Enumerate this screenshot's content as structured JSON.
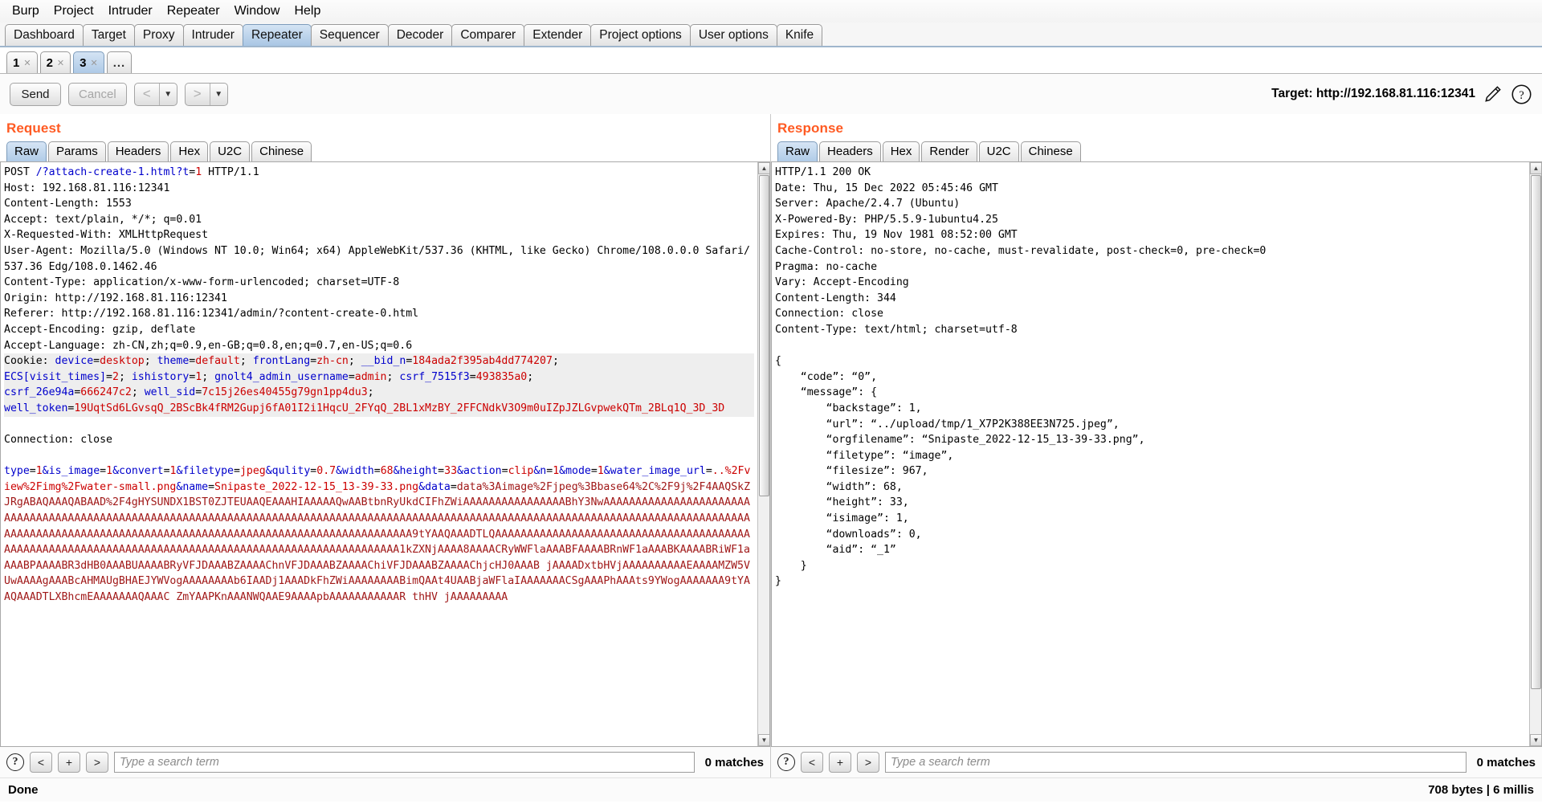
{
  "menubar": {
    "items": [
      "Burp",
      "Project",
      "Intruder",
      "Repeater",
      "Window",
      "Help"
    ]
  },
  "suite_tabs": {
    "items": [
      "Dashboard",
      "Target",
      "Proxy",
      "Intruder",
      "Repeater",
      "Sequencer",
      "Decoder",
      "Comparer",
      "Extender",
      "Project options",
      "User options",
      "Knife"
    ],
    "active": "Repeater"
  },
  "repeater_tabs": {
    "items": [
      "1",
      "2",
      "3"
    ],
    "active": "3",
    "more_label": "..."
  },
  "toolbar": {
    "send_label": "Send",
    "cancel_label": "Cancel",
    "back_arrow": "<",
    "forward_arrow": ">",
    "caret": "▼",
    "target_label": "Target: http://192.168.81.116:12341",
    "edit_icon": "pencil-icon",
    "help_icon": "question-icon"
  },
  "request": {
    "title": "Request",
    "tabs": [
      "Raw",
      "Params",
      "Headers",
      "Hex",
      "U2C",
      "Chinese"
    ],
    "active_tab": "Raw",
    "lines": {
      "l1_method": "POST ",
      "l1_path": "/?attach-create-1.html",
      "l1_q": "?t",
      "l1_eq": "=",
      "l1_val": "1",
      "l1_ver": " HTTP/1.1",
      "host": "Host: 192.168.81.116:12341",
      "content_length": "Content-Length: 1553",
      "accept": "Accept: text/plain, */*; q=0.01",
      "xrw": "X-Requested-With: XMLHttpRequest",
      "ua": "User-Agent: Mozilla/5.0 (Windows NT 10.0; Win64; x64) AppleWebKit/537.36 (KHTML, like Gecko) Chrome/108.0.0.0 Safari/537.36 Edg/108.0.1462.46",
      "content_type": "Content-Type: application/x-www-form-urlencoded; charset=UTF-8",
      "origin": "Origin: http://192.168.81.116:12341",
      "referer": "Referer: http://192.168.81.116:12341/admin/?content-create-0.html",
      "accept_encoding": "Accept-Encoding: gzip, deflate",
      "accept_language": "Accept-Language: zh-CN,zh;q=0.9,en-GB;q=0.8,en;q=0.7,en-US;q=0.6",
      "connection": "Connection: close"
    },
    "cookie": {
      "label": "Cookie: ",
      "pairs": [
        {
          "k": "device",
          "v": "desktop",
          "sep": "; "
        },
        {
          "k": "theme",
          "v": "default",
          "sep": "; "
        },
        {
          "k": "frontLang",
          "v": "zh-cn",
          "sep": "; "
        },
        {
          "k": "__bid_n",
          "v": "184ada2f395ab4dd774207",
          "sep": ";\n"
        },
        {
          "k": "ECS[visit_times]",
          "v": "2",
          "sep": "; "
        },
        {
          "k": "ishistory",
          "v": "1",
          "sep": "; "
        },
        {
          "k": "gnolt4_admin_username",
          "v": "admin",
          "sep": "; "
        },
        {
          "k": "csrf_7515f3",
          "v": "493835a0",
          "sep": ";\n"
        },
        {
          "k": "csrf_26e94a",
          "v": "666247c2",
          "sep": "; "
        },
        {
          "k": "well_sid",
          "v": "7c15j26es40455g79gn1pp4du3",
          "sep": ";\n"
        },
        {
          "k": "well_token",
          "v": "19UqtSd6LGvsqQ_2BScBk4fRM2Gupj6fA01I2i1HqcU_2FYqQ_2BL1xMzBY_2FFCNdkV3O9m0uIZpJZLGvpwekQTm_2BLq1Q_3D_3D",
          "sep": ""
        }
      ]
    },
    "body_params": [
      {
        "k": "type",
        "v": "1",
        "amp": "&"
      },
      {
        "k": "is_image",
        "v": "1",
        "amp": "&"
      },
      {
        "k": "convert",
        "v": "1",
        "amp": "&"
      },
      {
        "k": "filetype",
        "v": "jpeg",
        "amp": "&"
      },
      {
        "k": "qulity",
        "v": "0.7",
        "amp": "&"
      },
      {
        "k": "width",
        "v": "68",
        "amp": "&"
      },
      {
        "k": "height",
        "v": "33",
        "amp": "&"
      },
      {
        "k": "action",
        "v": "clip",
        "amp": "&"
      },
      {
        "k": "n",
        "v": "1",
        "amp": "&"
      },
      {
        "k": "mode",
        "v": "1",
        "amp": "&"
      },
      {
        "k": "water_image_url",
        "v": "..%2Fview%2Fimg%2Fwater-small.png",
        "amp": "&"
      },
      {
        "k": "name",
        "v": "Snipaste_2022-12-15_13-39-33.png",
        "amp": "&"
      },
      {
        "k": "data",
        "v": "",
        "amp": ""
      }
    ],
    "body_data_value": "data%3Aimage%2Fjpeg%3Bbase64%2C%2F9j%2F4AAQSkZJRgABAQAAAQABAAD%2F4gHYSUNDX1BST0ZJTEUAAQEAAAHIAAAAAQwAABtbnRyUkdCIFhZWiAAAAAAAAAAAAAAAABhY3NwAAAAAAAAAAAAAAAAAAAAAAAAAAAAAAAAAAAAAAAAAAAAAAAAAAAAAAAAAAAAAAAAAAAAAAAAAAAAAAAAAAAAAAAAAAAAAAAAAAAAAAAAAAAAAAAAAAAAAAAAAAAAAAAAAAAAAAAAAAAAAAAAAAAAAAAAAAAAAAAAAAAAAAAAAAAAAAAAAAAAAAAAAAAAAAAAAAAAAAAAAAAA9tYAAQAAADTLQAAAAAAAAAAAAAAAAAAAAAAAAAAAAAAAAAAAAAAAAAAAAAAAAAAAAAAAAAAAAAAAAAAAAAAAAAAAAAAAAAAAAAAAAAAAAAAAAAAAAAA1kZXNjAAAA8AAAACRyWWFlaAAABFAAAABRnWF1aAAABKAAAABRiWF1aAAABPAAAABR3dHB0AAABUAAAABRyVFJDAAABZAAAAChnVFJDAAABZAAAAChiVFJDAAABZAAAAChjcHJ0AAAB jAAAADxtbHVjAAAAAAAAAAEAAAAMZW5VUwAAAAgAAABcAHMAUgBHAEJYWVogAAAAAAAAb6IAADj1AAADkFhZWiAAAAAAAABimQAAt4UAABjaWFlaIAAAAAAACSgAAAPhAAAts9YWog",
    "more_b64": "AAAAAAA9tYAAQAAADTLXBhcmEAAAAAAAQAAAC ZmYAAPKnAAANWQAAE9AAAApbAAAAAAAAAAAR thHV jAAAAAAAAA"
  },
  "response": {
    "title": "Response",
    "tabs": [
      "Raw",
      "Headers",
      "Hex",
      "Render",
      "U2C",
      "Chinese"
    ],
    "active_tab": "Raw",
    "status_line": "HTTP/1.1 200 OK",
    "headers": [
      "Date: Thu, 15 Dec 2022 05:45:46 GMT",
      "Server: Apache/2.4.7 (Ubuntu)",
      "X-Powered-By: PHP/5.5.9-1ubuntu4.25",
      "Expires: Thu, 19 Nov 1981 08:52:00 GMT",
      "Cache-Control: no-store, no-cache, must-revalidate, post-check=0, pre-check=0",
      "Pragma: no-cache",
      "Vary: Accept-Encoding",
      "Content-Length: 344",
      "Connection: close",
      "Content-Type: text/html; charset=utf-8"
    ],
    "body": "{\n    “code”: “0”,\n    “message”: {\n        “backstage”: 1,\n        “url”: “../upload/tmp/1_X7P2K388EE3N725.jpeg”,\n        “orgfilename”: “Snipaste_2022-12-15_13-39-33.png”,\n        “filetype”: “image”,\n        “filesize”: 967,\n        “width”: 68,\n        “height”: 33,\n        “isimage”: 1,\n        “downloads”: 0,\n        “aid”: “_1”\n    }\n}"
  },
  "search": {
    "help_icon": "?",
    "prev_label": "<",
    "add_label": "+",
    "next_label": ">",
    "placeholder": "Type a search term",
    "matches_label": "0 matches"
  },
  "status": {
    "left": "Done",
    "right": "708 bytes | 6 millis"
  }
}
